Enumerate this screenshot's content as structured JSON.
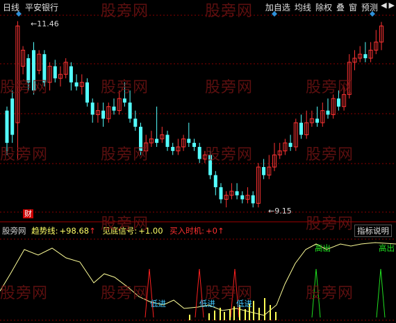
{
  "header": {
    "period": "日线",
    "stock": "平安银行",
    "buttons": [
      "加自选",
      "均线",
      "除权",
      "叠",
      "窗",
      "预测"
    ],
    "nav_left": "◀",
    "nav_right": "▶"
  },
  "watermark": "股旁网",
  "price_chart": {
    "high_label": "11.46",
    "low_label": "9.15",
    "marker": "财",
    "colors": {
      "up": "#ff3333",
      "down": "#54ffff",
      "grid": "#8b0000",
      "marker_blue": "#2f8fd8"
    }
  },
  "indicator": {
    "name": "股旁网",
    "trend_label": "趋势线:",
    "trend_value": "+98.68",
    "trend_arrow": "↑",
    "signal_label": "见底信号:",
    "signal_value": "+1.00",
    "buy_label": "买入时机:",
    "buy_value": "+0",
    "buy_arrow": "↑",
    "help_button": "指标说明",
    "signals": {
      "low_entry": "低进",
      "high_exit": "高出"
    },
    "colors": {
      "trend": "#ffff99",
      "buy": "#ff2020",
      "sell": "#20e020",
      "bars": "#ffff55",
      "low_text": "#40c8ff",
      "high_text": "#20e020"
    }
  }
}
